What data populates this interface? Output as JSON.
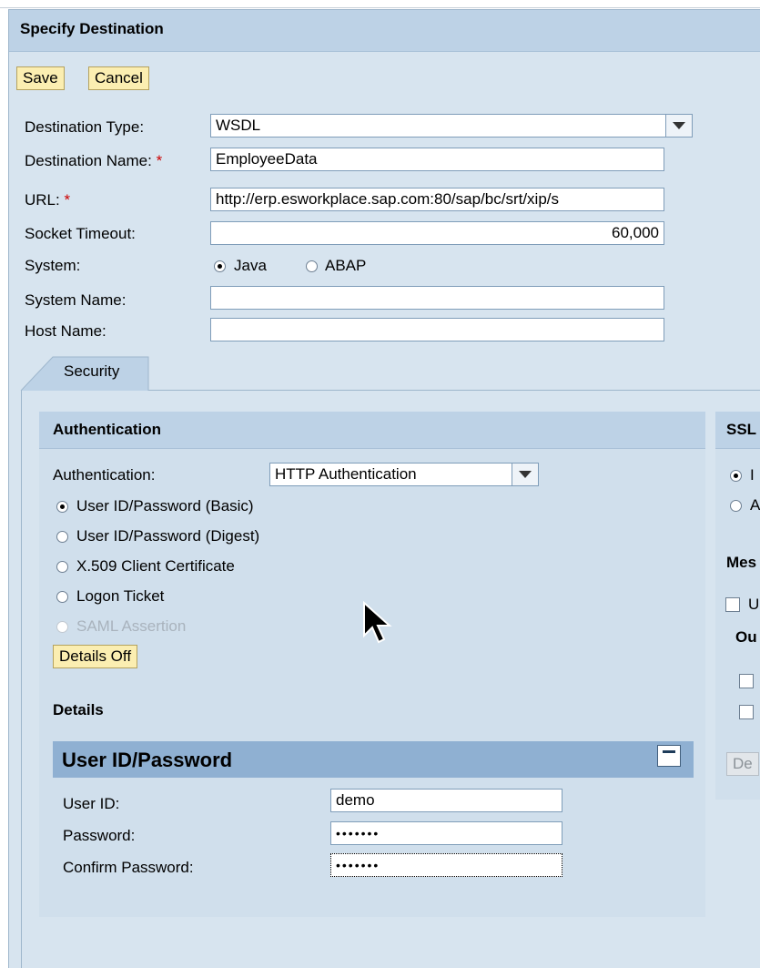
{
  "title": "Specify Destination",
  "toolbar": {
    "save": "Save",
    "cancel": "Cancel"
  },
  "form": {
    "destination_type": {
      "label": "Destination Type:",
      "value": "WSDL"
    },
    "destination_name": {
      "label": "Destination Name:",
      "required": "*",
      "value": "EmployeeData"
    },
    "url": {
      "label": "URL:",
      "required": "*",
      "value": "http://erp.esworkplace.sap.com:80/sap/bc/srt/xip/s"
    },
    "socket_timeout": {
      "label": "Socket Timeout:",
      "value": "60,000"
    },
    "system": {
      "label": "System:",
      "options": [
        "Java",
        "ABAP"
      ],
      "selected": "Java"
    },
    "system_name": {
      "label": "System Name:",
      "value": ""
    },
    "host_name": {
      "label": "Host Name:",
      "value": ""
    }
  },
  "tab": {
    "label": "Security"
  },
  "authentication": {
    "header": "Authentication",
    "label": "Authentication:",
    "value": "HTTP Authentication",
    "options": [
      "User ID/Password (Basic)",
      "User ID/Password (Digest)",
      "X.509 Client Certificate",
      "Logon Ticket",
      "SAML Assertion"
    ],
    "selected": "User ID/Password (Basic)",
    "details_button": "Details Off",
    "details_header": "Details"
  },
  "credentials": {
    "header": "User ID/Password",
    "user_id_label": "User ID:",
    "user_id": "demo",
    "password_label": "Password:",
    "password": "•••••••",
    "confirm_label": "Confirm Password:",
    "confirm": "•••••••"
  },
  "ssl_panel": {
    "header": "SSL",
    "radio1": "I",
    "radio2": "A",
    "section_label": "Mes",
    "check_label": "U",
    "sub_label": "Ou",
    "button": "De"
  },
  "colors": {
    "button_bg": "#fbeeb1",
    "panel_header": "#bdd2e6",
    "frame_bg": "#d7e4ef",
    "required": "#cc0000"
  }
}
